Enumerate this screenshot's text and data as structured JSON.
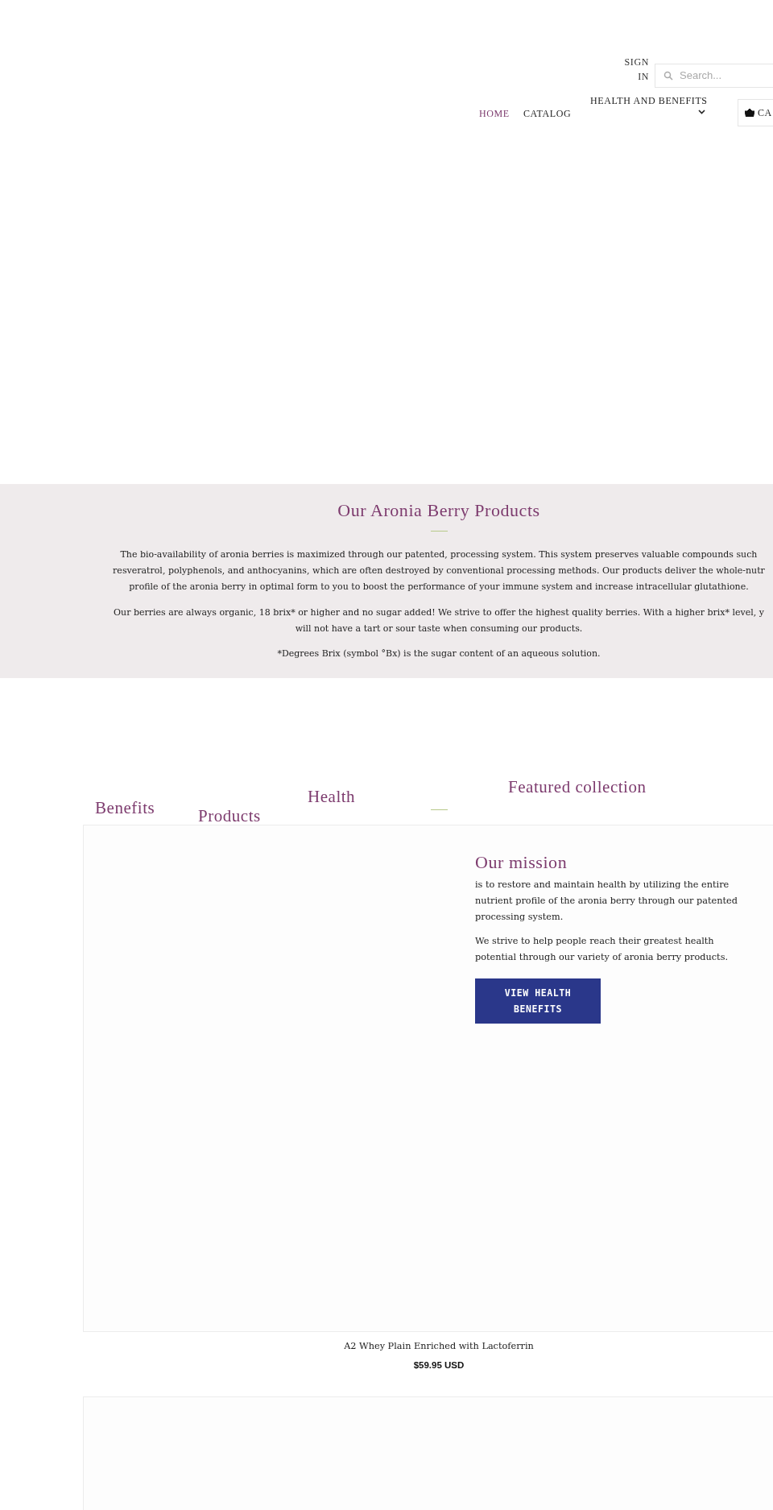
{
  "header": {
    "sign_in": "SIGN IN",
    "search": {
      "placeholder": "Search..."
    },
    "nav": [
      {
        "label": "HOME",
        "selected": true,
        "kind": "link"
      },
      {
        "label": "CATALOG",
        "selected": false,
        "kind": "link"
      },
      {
        "label": "HEALTH AND BENEFITS",
        "selected": false,
        "kind": "dropdown"
      }
    ],
    "cart": {
      "label": "CA"
    }
  },
  "products_intro": {
    "title": "Our Aronia Berry Products",
    "paragraphs": [
      [
        "The bio-availability of aronia berries is maximized through our patented, processing system. This system preserves valuable compounds such",
        "resveratrol, polyphenols, and anthocyanins, which are often destroyed by conventional processing methods. Our products deliver the whole-nutr",
        "profile of the aronia berry in optimal form to you to boost the performance of your immune system and increase intracellular glutathione."
      ],
      [
        "Our berries are always organic, 18 brix* or higher and no sugar added! We strive to offer the highest quality berries. With a higher brix* level, y",
        "will not have a tart or sour taste when consuming our products."
      ],
      [
        "*Degrees Brix (symbol °Bx) is the sugar content of an aqueous solution."
      ]
    ]
  },
  "headings": [
    "Benefits",
    "Products",
    "Health",
    "Featured collection"
  ],
  "mission": {
    "title": "Our mission",
    "paragraphs": [
      "is to restore and maintain health by utilizing the entire nutrient profile of the aronia berry through our patented processing system.",
      "We strive to help people reach their greatest health potential through our variety of aronia berry products."
    ],
    "button": "VIEW HEALTH BENEFITS"
  },
  "product": {
    "name": "A2 Whey Plain Enriched with Lactoferrin",
    "price": "$59.95 USD"
  }
}
